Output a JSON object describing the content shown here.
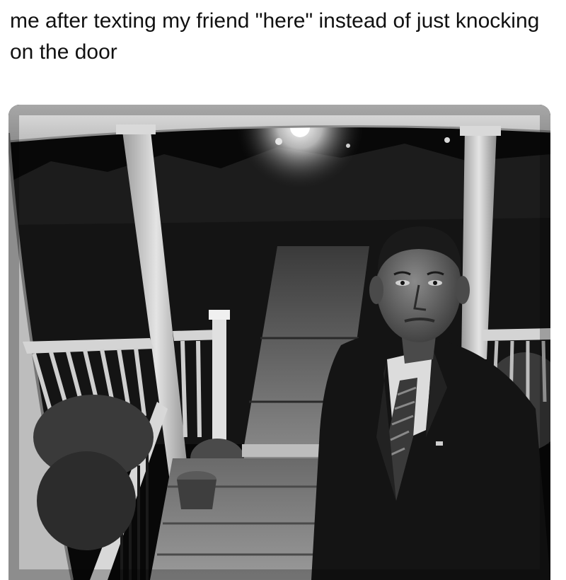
{
  "post": {
    "caption": "me after texting my friend \"here\" instead of just knocking on the door"
  },
  "image": {
    "alt": "Black-and-white doorbell camera photo of a man in a suit standing on a front porch at night"
  },
  "colors": {
    "background": "#ffffff",
    "caption_text": "#111111"
  }
}
